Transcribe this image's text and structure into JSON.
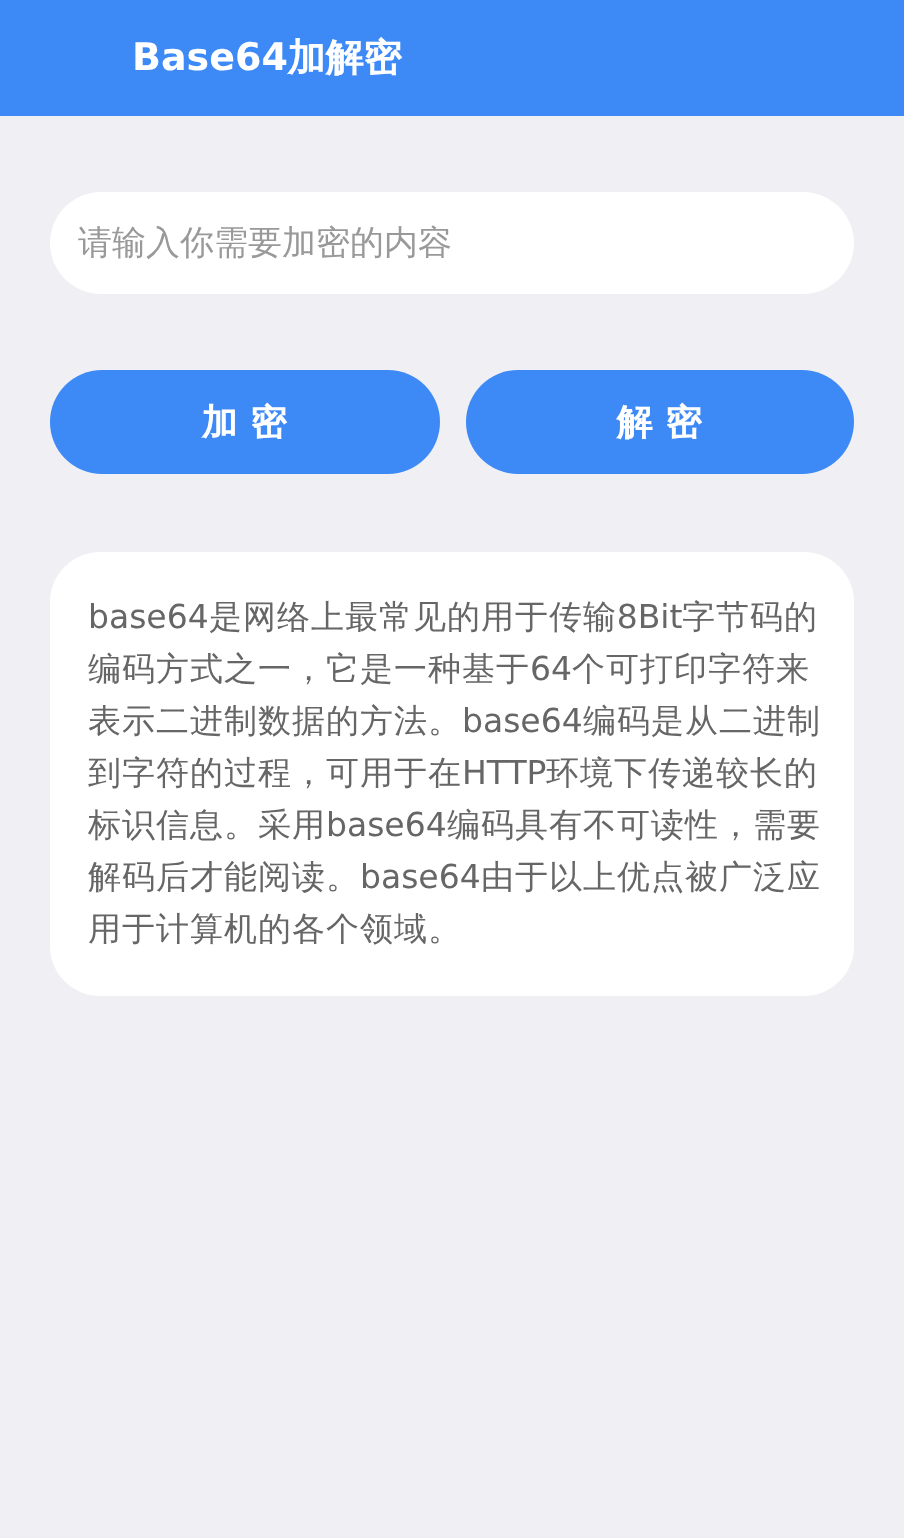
{
  "header": {
    "title": "Base64加解密"
  },
  "input": {
    "placeholder": "请输入你需要加密的内容"
  },
  "buttons": [
    {
      "label": "加 密"
    },
    {
      "label": "解 密"
    }
  ],
  "description": "base64是网络上最常见的用于传输8Bit字节码的编码方式之一，它是一种基于64个可打印字符来表示二进制数据的方法。base64编码是从二进制到字符的过程，可用于在HTTP环境下传递较长的标识信息。采用base64编码具有不可读性，需要解码后才能阅读。base64由于以上优点被广泛应用于计算机的各个领域。"
}
